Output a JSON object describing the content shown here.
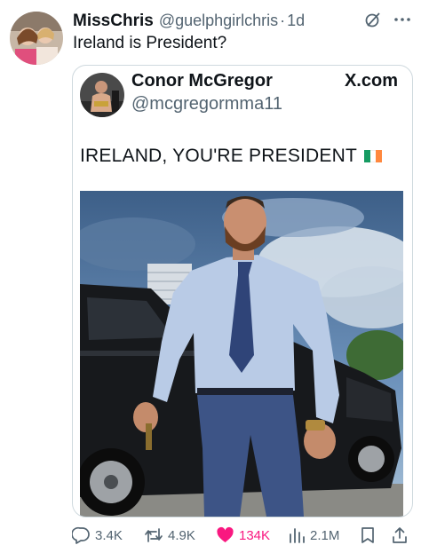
{
  "post": {
    "name": "MissChris",
    "handle": "@guelphgirlchris",
    "separator": "·",
    "time": "1d",
    "text": "Ireland is President?"
  },
  "quoted": {
    "name": "Conor McGregor",
    "handle": "@mcgregormma11",
    "site": "X.com",
    "text": "IRELAND, YOU'RE PRESIDENT"
  },
  "actions": {
    "replies": "3.4K",
    "reposts": "4.9K",
    "likes": "134K",
    "views": "2.1M"
  },
  "colors": {
    "like_active": "#f91880",
    "secondary_text": "#536471",
    "flag": [
      "#169b62",
      "#ffffff",
      "#ff883e"
    ]
  },
  "icons": [
    "grok-icon",
    "more-icon",
    "reply-icon",
    "repost-icon",
    "like-icon",
    "views-icon",
    "bookmark-icon",
    "share-icon"
  ]
}
